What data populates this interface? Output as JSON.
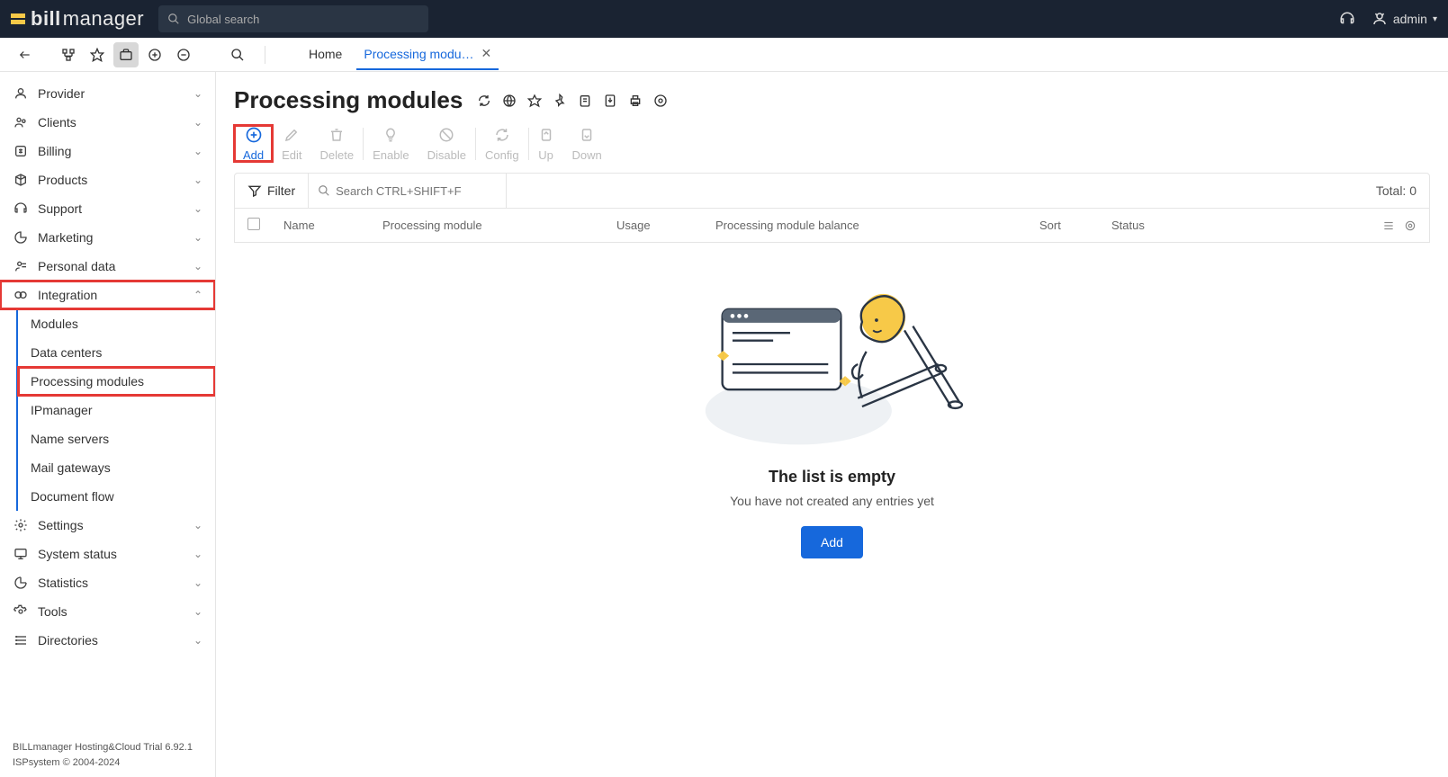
{
  "header": {
    "logo_bold": "bill",
    "logo_light": "manager",
    "search_placeholder": "Global search",
    "user_name": "admin"
  },
  "tabs": {
    "home": "Home",
    "active": "Processing modu…"
  },
  "sidebar": {
    "items": [
      {
        "label": "Provider"
      },
      {
        "label": "Clients"
      },
      {
        "label": "Billing"
      },
      {
        "label": "Products"
      },
      {
        "label": "Support"
      },
      {
        "label": "Marketing"
      },
      {
        "label": "Personal data"
      },
      {
        "label": "Integration"
      },
      {
        "label": "Settings"
      },
      {
        "label": "System status"
      },
      {
        "label": "Statistics"
      },
      {
        "label": "Tools"
      },
      {
        "label": "Directories"
      }
    ],
    "integration_sub": [
      {
        "label": "Modules"
      },
      {
        "label": "Data centers"
      },
      {
        "label": "Processing modules"
      },
      {
        "label": "IPmanager"
      },
      {
        "label": "Name servers"
      },
      {
        "label": "Mail gateways"
      },
      {
        "label": "Document flow"
      }
    ],
    "footer_line1": "BILLmanager Hosting&Cloud Trial 6.92.1",
    "footer_line2": "ISPsystem © 2004-2024"
  },
  "page": {
    "title": "Processing modules",
    "toolbar": {
      "add": "Add",
      "edit": "Edit",
      "delete": "Delete",
      "enable": "Enable",
      "disable": "Disable",
      "config": "Config",
      "up": "Up",
      "down": "Down"
    },
    "filter_label": "Filter",
    "search_placeholder": "Search CTRL+SHIFT+F",
    "total_label": "Total: 0",
    "columns": {
      "name": "Name",
      "processing_module": "Processing module",
      "usage": "Usage",
      "balance": "Processing module balance",
      "sort": "Sort",
      "status": "Status"
    },
    "empty": {
      "title": "The list is empty",
      "subtitle": "You have not created any entries yet",
      "button": "Add"
    }
  }
}
